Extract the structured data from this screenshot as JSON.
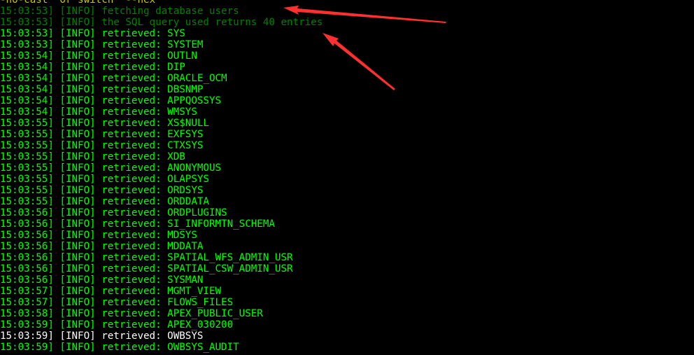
{
  "terminal": {
    "header": "-no-cast  or switch  --hex",
    "lines": [
      {
        "time": "15:03:53]",
        "level": "[INFO]",
        "message": "fetching database users",
        "style": "dim"
      },
      {
        "time": "15:03:53]",
        "level": "[INFO]",
        "message": "the SQL query used returns 40 entries",
        "style": "dim"
      },
      {
        "time": "15:03:53]",
        "level": "[INFO]",
        "message": "retrieved: SYS",
        "style": "normal"
      },
      {
        "time": "15:03:53]",
        "level": "[INFO]",
        "message": "retrieved: SYSTEM",
        "style": "normal"
      },
      {
        "time": "15:03:54]",
        "level": "[INFO]",
        "message": "retrieved: OUTLN",
        "style": "normal"
      },
      {
        "time": "15:03:54]",
        "level": "[INFO]",
        "message": "retrieved: DIP",
        "style": "normal"
      },
      {
        "time": "15:03:54]",
        "level": "[INFO]",
        "message": "retrieved: ORACLE_OCM",
        "style": "normal"
      },
      {
        "time": "15:03:54]",
        "level": "[INFO]",
        "message": "retrieved: DBSNMP",
        "style": "normal"
      },
      {
        "time": "15:03:54]",
        "level": "[INFO]",
        "message": "retrieved: APPQOSSYS",
        "style": "normal"
      },
      {
        "time": "15:03:54]",
        "level": "[INFO]",
        "message": "retrieved: WMSYS",
        "style": "normal"
      },
      {
        "time": "15:03:55]",
        "level": "[INFO]",
        "message": "retrieved: XS$NULL",
        "style": "normal"
      },
      {
        "time": "15:03:55]",
        "level": "[INFO]",
        "message": "retrieved: EXFSYS",
        "style": "normal"
      },
      {
        "time": "15:03:55]",
        "level": "[INFO]",
        "message": "retrieved: CTXSYS",
        "style": "normal"
      },
      {
        "time": "15:03:55]",
        "level": "[INFO]",
        "message": "retrieved: XDB",
        "style": "normal"
      },
      {
        "time": "15:03:55]",
        "level": "[INFO]",
        "message": "retrieved: ANONYMOUS",
        "style": "normal"
      },
      {
        "time": "15:03:55]",
        "level": "[INFO]",
        "message": "retrieved: OLAPSYS",
        "style": "normal"
      },
      {
        "time": "15:03:55]",
        "level": "[INFO]",
        "message": "retrieved: ORDSYS",
        "style": "normal"
      },
      {
        "time": "15:03:55]",
        "level": "[INFO]",
        "message": "retrieved: ORDDATA",
        "style": "normal"
      },
      {
        "time": "15:03:56]",
        "level": "[INFO]",
        "message": "retrieved: ORDPLUGINS",
        "style": "normal"
      },
      {
        "time": "15:03:56]",
        "level": "[INFO]",
        "message": "retrieved: SI_INFORMTN_SCHEMA",
        "style": "normal"
      },
      {
        "time": "15:03:56]",
        "level": "[INFO]",
        "message": "retrieved: MDSYS",
        "style": "normal"
      },
      {
        "time": "15:03:56]",
        "level": "[INFO]",
        "message": "retrieved: MDDATA",
        "style": "normal"
      },
      {
        "time": "15:03:56]",
        "level": "[INFO]",
        "message": "retrieved: SPATIAL_WFS_ADMIN_USR",
        "style": "normal"
      },
      {
        "time": "15:03:56]",
        "level": "[INFO]",
        "message": "retrieved: SPATIAL_CSW_ADMIN_USR",
        "style": "normal"
      },
      {
        "time": "15:03:56]",
        "level": "[INFO]",
        "message": "retrieved: SYSMAN",
        "style": "normal"
      },
      {
        "time": "15:03:57]",
        "level": "[INFO]",
        "message": "retrieved: MGMT_VIEW",
        "style": "normal"
      },
      {
        "time": "15:03:57]",
        "level": "[INFO]",
        "message": "retrieved: FLOWS_FILES",
        "style": "normal"
      },
      {
        "time": "15:03:58]",
        "level": "[INFO]",
        "message": "retrieved: APEX_PUBLIC_USER",
        "style": "normal"
      },
      {
        "time": "15:03:59]",
        "level": "[INFO]",
        "message": "retrieved: APEX_030200",
        "style": "normal"
      },
      {
        "time": "15:03:59]",
        "level": "[INFO]",
        "message": "retrieved: OWBSYS",
        "style": "white"
      },
      {
        "time": "15:03:59]",
        "level": "[INFO]",
        "message": "retrieved: OWBSYS_AUDIT",
        "style": "normal"
      }
    ]
  },
  "colors": {
    "background": "#000000",
    "log_green": "#00ff00",
    "log_dim_green": "#008000",
    "log_white": "#ffffff",
    "header_yellow": "#c8c800",
    "arrow_red": "#ff3030"
  }
}
